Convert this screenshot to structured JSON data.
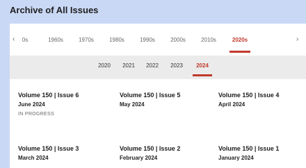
{
  "page": {
    "title": "Archive of All Issues"
  },
  "decades": {
    "prev_arrow": "‹",
    "next_arrow": "›",
    "items": [
      "0s",
      "1960s",
      "1970s",
      "1980s",
      "1990s",
      "2000s",
      "2010s",
      "2020s"
    ],
    "selected": "2020s"
  },
  "years": {
    "items": [
      "2020",
      "2021",
      "2022",
      "2023",
      "2024"
    ],
    "selected": "2024"
  },
  "issues": [
    {
      "title": "Volume 150 | Issue 6",
      "date": "June 2024",
      "status": "IN PROGRESS"
    },
    {
      "title": "Volume 150 | Issue 5",
      "date": "May 2024",
      "status": ""
    },
    {
      "title": "Volume 150 | Issue 4",
      "date": "April 2024",
      "status": ""
    },
    {
      "title": "Volume 150 | Issue 3",
      "date": "March 2024",
      "status": ""
    },
    {
      "title": "Volume 150 | Issue 2",
      "date": "February 2024",
      "status": ""
    },
    {
      "title": "Volume 150 | Issue 1",
      "date": "January 2024",
      "status": ""
    }
  ],
  "colors": {
    "accent": "#c0392b",
    "background": "#c9d8f5",
    "year_bar": "#ebebeb"
  }
}
